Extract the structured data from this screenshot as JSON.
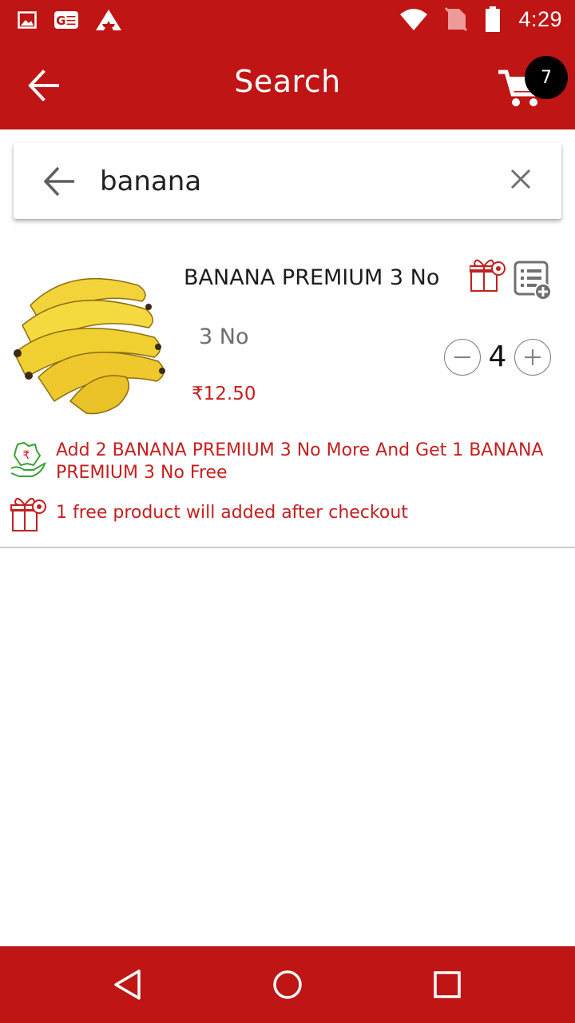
{
  "status_bar": {
    "time": "4:29",
    "left_icons": [
      "image-icon",
      "ge-icon",
      "app-logo-icon"
    ],
    "right_icons": [
      "wifi-icon",
      "no-sim-icon",
      "battery-icon"
    ]
  },
  "app_bar": {
    "title": "Search",
    "cart_count": "7",
    "icons": [
      "back-arrow-icon",
      "cart-icon"
    ]
  },
  "search": {
    "value": "banana",
    "icons": [
      "back-arrow-icon",
      "close-icon"
    ]
  },
  "product": {
    "name": "BANANA PREMIUM 3 No",
    "unit": "3 No",
    "price": "₹12.50",
    "quantity": "4",
    "offer_text": "Add 2 BANANA PREMIUM 3 No More And Get 1 BANANA PREMIUM 3 No Free",
    "free_note": "1 free product will added after checkout",
    "icons": [
      "banana-image",
      "gift-offer-icon",
      "add-to-list-icon",
      "rupee-hand-icon",
      "gift-icon",
      "minus-icon",
      "plus-icon"
    ]
  },
  "nav_bar": {
    "icons": [
      "nav-back-icon",
      "nav-home-icon",
      "nav-recent-icon"
    ]
  },
  "colors": {
    "primary": "#bf1515",
    "price": "#c42020",
    "offer_green": "#3aa335",
    "badge": "#000000"
  }
}
